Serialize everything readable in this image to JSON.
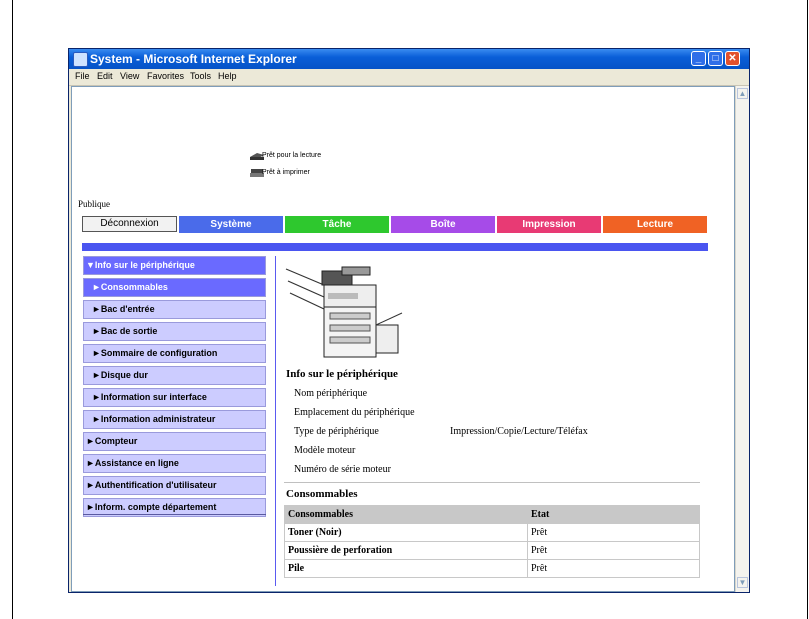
{
  "window": {
    "title": "System - Microsoft Internet Explorer"
  },
  "menubar": [
    "File",
    "Edit",
    "View",
    "Favorites",
    "Tools",
    "Help"
  ],
  "status": {
    "scan": "Prêt pour la lecture",
    "print": "Prêt à imprimer"
  },
  "mode": "Publique",
  "logout_label": "Déconnexion",
  "tabs": {
    "systeme": "Système",
    "tache": "Tâche",
    "boite": "Boîte",
    "impression": "Impression",
    "lecture": "Lecture"
  },
  "tab_colors": {
    "systeme": "#4a6bea",
    "tache": "#2ec82e",
    "boite": "#a64be8",
    "impression": "#e83a74",
    "lecture": "#f06224"
  },
  "sidebar": [
    "▼Info sur le périphérique",
    "►Consommables",
    "►Bac d'entrée",
    "►Bac de sortie",
    "►Sommaire de configuration",
    "►Disque dur",
    "►Information sur interface",
    "►Information administrateur",
    "►Compteur",
    "►Assistance en ligne",
    "►Authentification d'utilisateur",
    "►Inform. compte département"
  ],
  "device_info": {
    "title": "Info sur le périphérique",
    "rows": [
      {
        "label": "Nom périphérique",
        "value": ""
      },
      {
        "label": "Emplacement du périphérique",
        "value": ""
      },
      {
        "label": "Type de périphérique",
        "value": "Impression/Copie/Lecture/Téléfax"
      },
      {
        "label": "Modèle moteur",
        "value": ""
      },
      {
        "label": "Numéro de série moteur",
        "value": ""
      }
    ]
  },
  "consumables": {
    "title": "Consommables",
    "headers": [
      "Consommables",
      "Etat"
    ],
    "rows": [
      [
        "Toner (Noir)",
        "Prêt"
      ],
      [
        "Poussière de perforation",
        "Prêt"
      ],
      [
        "Pile",
        "Prêt"
      ]
    ]
  }
}
